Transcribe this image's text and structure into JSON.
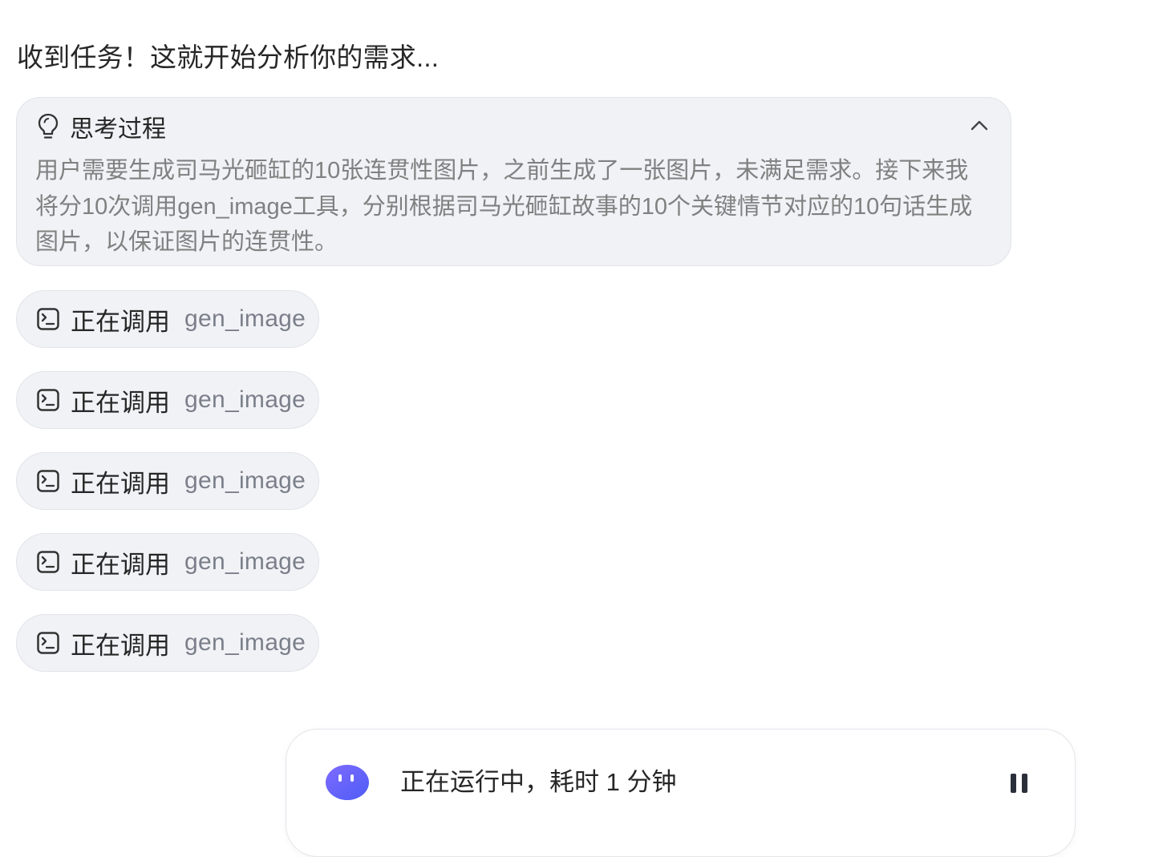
{
  "intro_text": "收到任务！这就开始分析你的需求...",
  "thinking": {
    "title": "思考过程",
    "content": "用户需要生成司马光砸缸的10张连贯性图片，之前生成了一张图片，未满足需求。接下来我将分10次调用gen_image工具，分别根据司马光砸缸故事的10个关键情节对应的10句话生成图片，以保证图片的连贯性。",
    "expanded": true,
    "icon": "lightbulb-icon",
    "toggle_icon": "chevron-up-icon"
  },
  "tool_calls": [
    {
      "action": "正在调用",
      "tool": "gen_image",
      "icon": "terminal-icon"
    },
    {
      "action": "正在调用",
      "tool": "gen_image",
      "icon": "terminal-icon"
    },
    {
      "action": "正在调用",
      "tool": "gen_image",
      "icon": "terminal-icon"
    },
    {
      "action": "正在调用",
      "tool": "gen_image",
      "icon": "terminal-icon"
    },
    {
      "action": "正在调用",
      "tool": "gen_image",
      "icon": "terminal-icon"
    }
  ],
  "status": {
    "text": "正在运行中，耗时 1 分钟",
    "avatar_icon": "agent-avatar-icon",
    "control_icon": "pause-icon"
  },
  "colors": {
    "panel_bg": "#f1f2f6",
    "panel_border": "#e2e4ea",
    "muted_text": "#808080",
    "accent": "#6a5cff"
  }
}
